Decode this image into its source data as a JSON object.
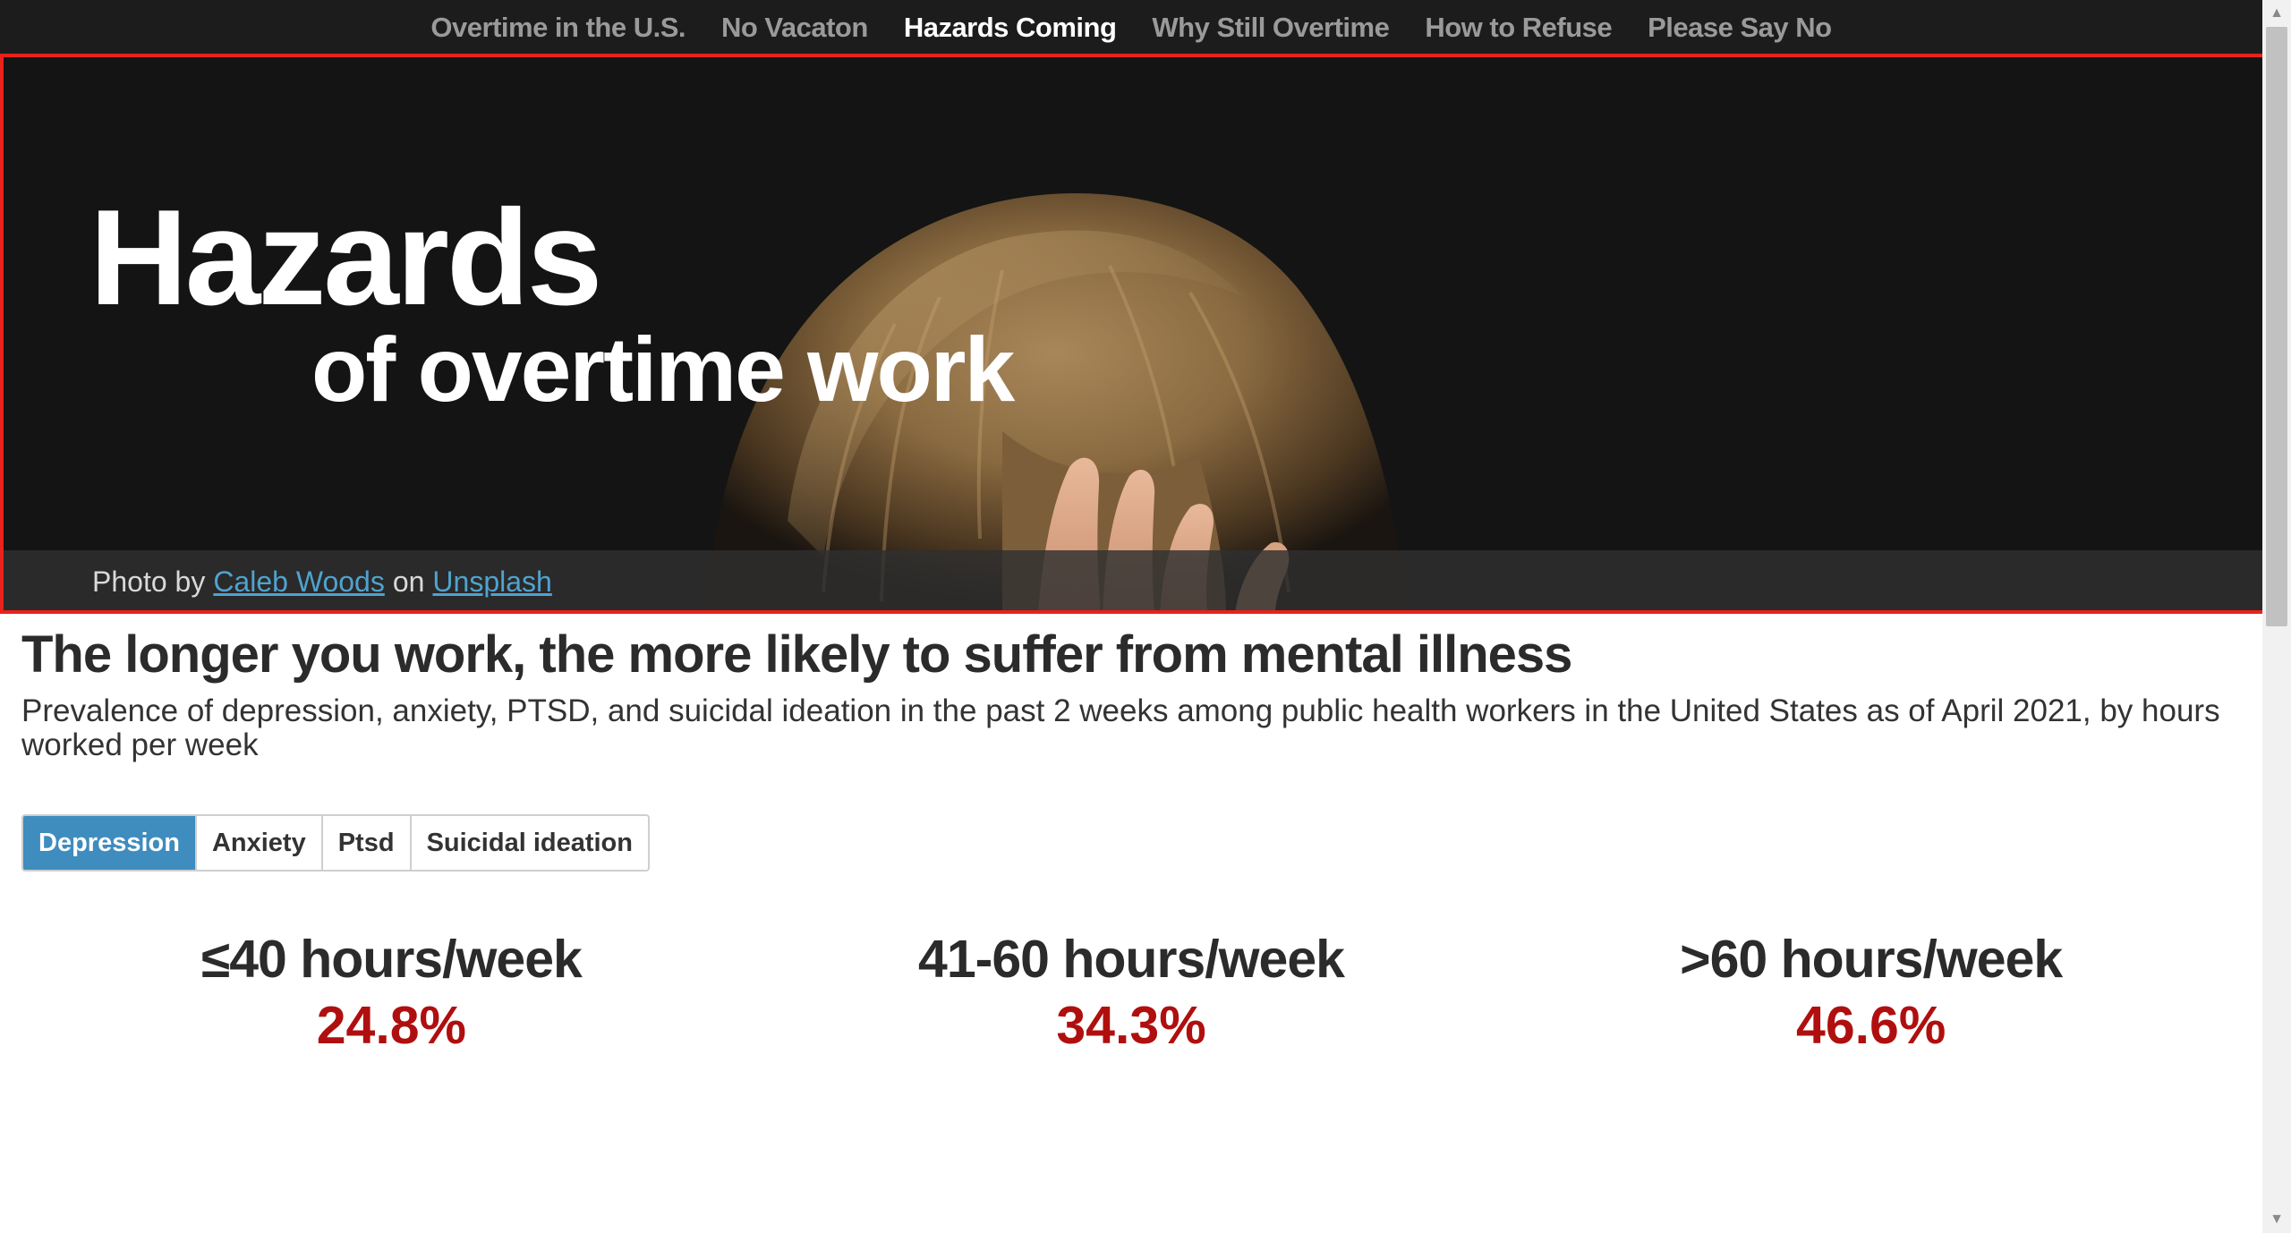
{
  "nav": {
    "items": [
      {
        "label": "Overtime in the U.S.",
        "active": false
      },
      {
        "label": "No Vacaton",
        "active": false
      },
      {
        "label": "Hazards Coming",
        "active": true
      },
      {
        "label": "Why Still Overtime",
        "active": false
      },
      {
        "label": "How to Refuse",
        "active": false
      },
      {
        "label": "Please Say No",
        "active": false
      }
    ]
  },
  "hero": {
    "title": "Hazards",
    "subtitle": "of overtime work",
    "credit": {
      "prefix": "Photo by",
      "author": "Caleb Woods",
      "middle": "on",
      "site": "Unsplash"
    }
  },
  "section": {
    "headline": "The longer you work, the more likely to suffer from mental illness",
    "description": "Prevalence of depression, anxiety, PTSD, and suicidal ideation in the past 2 weeks among public health workers in the United States as of April 2021, by hours worked per week"
  },
  "tabs": [
    {
      "label": "Depression",
      "active": true
    },
    {
      "label": "Anxiety",
      "active": false
    },
    {
      "label": "Ptsd",
      "active": false
    },
    {
      "label": "Suicidal ideation",
      "active": false
    }
  ],
  "stats": [
    {
      "label": "≤40 hours/week",
      "value": "24.8%"
    },
    {
      "label": "41-60 hours/week",
      "value": "34.3%"
    },
    {
      "label": ">60 hours/week",
      "value": "46.6%"
    }
  ],
  "colors": {
    "nav_background": "#1c1c1c",
    "active_tab": "#3f8cbf",
    "stat_value": "#b00f0f",
    "link": "#4fa3cf",
    "outline": "#e8221c"
  }
}
